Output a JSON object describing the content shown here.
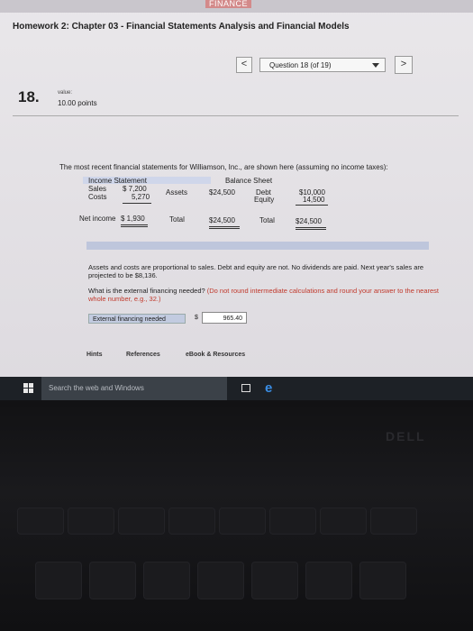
{
  "header": {
    "badge": "FINANCE",
    "title": "Homework 2: Chapter 03 - Financial Statements Analysis and Financial Models"
  },
  "nav": {
    "prev": "<",
    "question_select": "Question 18 (of 19)",
    "next": ">"
  },
  "question": {
    "number": "18.",
    "value_label": "value:",
    "points": "10.00 points"
  },
  "problem": {
    "intro": "The most recent financial statements for Williamson, Inc., are shown here (assuming no income taxes):",
    "income": {
      "header": "Income Statement",
      "sales_label": "Sales",
      "sales_value": "$ 7,200",
      "costs_label": "Costs",
      "costs_value": "5,270",
      "net_label": "Net income",
      "net_value": "$ 1,930"
    },
    "balance": {
      "header": "Balance Sheet",
      "assets_label": "Assets",
      "assets_value": "$24,500",
      "debt_label": "Debt",
      "debt_value": "$10,000",
      "equity_label": "Equity",
      "equity_value": "14,500",
      "total_label_left": "Total",
      "total_left_value": "$24,500",
      "total_label_right": "Total",
      "total_right_value": "$24,500"
    },
    "assumptions": "Assets and costs are proportional to sales. Debt and equity are not. No dividends are paid. Next year's sales are projected to be $8,136.",
    "question_text": "What is the external financing needed?",
    "question_hint": "(Do not round intermediate calculations and round your answer to the nearest whole number, e.g., 32.)",
    "efn_label": "External financing needed",
    "currency": "$",
    "answer_value": "965.40"
  },
  "footer_links": {
    "hints": "Hints",
    "references": "References",
    "ebook": "eBook & Resources"
  },
  "taskbar": {
    "search_placeholder": "Search the web and Windows"
  },
  "laptop": {
    "brand": "DELL"
  }
}
